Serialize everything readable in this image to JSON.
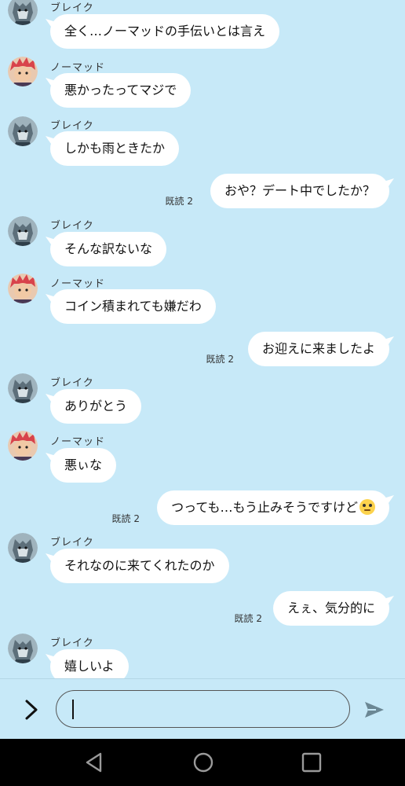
{
  "colors": {
    "chat_background": "#c7e9f8",
    "bubble": "#ffffff",
    "nav_bar": "#000000"
  },
  "messages": [
    {
      "side": "in",
      "sender": "ブレイク",
      "avatar": "wolf",
      "text": "全く…ノーマッドの手伝いとは言え"
    },
    {
      "side": "in",
      "sender": "ノーマッド",
      "avatar": "redhead",
      "text": "悪かったってマジで"
    },
    {
      "side": "in",
      "sender": "ブレイク",
      "avatar": "wolf",
      "text": "しかも雨ときたか"
    },
    {
      "side": "out",
      "read": "既読 2",
      "text": "おや？デート中でしたか？"
    },
    {
      "side": "in",
      "sender": "ブレイク",
      "avatar": "wolf",
      "text": "そんな訳ないな"
    },
    {
      "side": "in",
      "sender": "ノーマッド",
      "avatar": "redhead",
      "text": "コイン積まれても嫌だわ"
    },
    {
      "side": "out",
      "read": "既読 2",
      "text": "お迎えに来ましたよ"
    },
    {
      "side": "in",
      "sender": "ブレイク",
      "avatar": "wolf",
      "text": "ありがとう"
    },
    {
      "side": "in",
      "sender": "ノーマッド",
      "avatar": "redhead",
      "text": "悪ぃな"
    },
    {
      "side": "out",
      "read": "既読 2",
      "text": "つっても…もう止みそうですけど",
      "emoji": "face-with-rolling-eyes"
    },
    {
      "side": "in",
      "sender": "ブレイク",
      "avatar": "wolf",
      "text": "それなのに来てくれたのか"
    },
    {
      "side": "out",
      "read": "既読 2",
      "text": "えぇ、気分的に"
    },
    {
      "side": "in",
      "sender": "ブレイク",
      "avatar": "wolf",
      "text": "嬉しいよ"
    }
  ],
  "input": {
    "value": "",
    "expand_icon": "chevron-right-icon",
    "send_icon": "send-icon"
  },
  "navbar": {
    "back_icon": "back-triangle-icon",
    "home_icon": "home-circle-icon",
    "recents_icon": "recents-square-icon"
  }
}
